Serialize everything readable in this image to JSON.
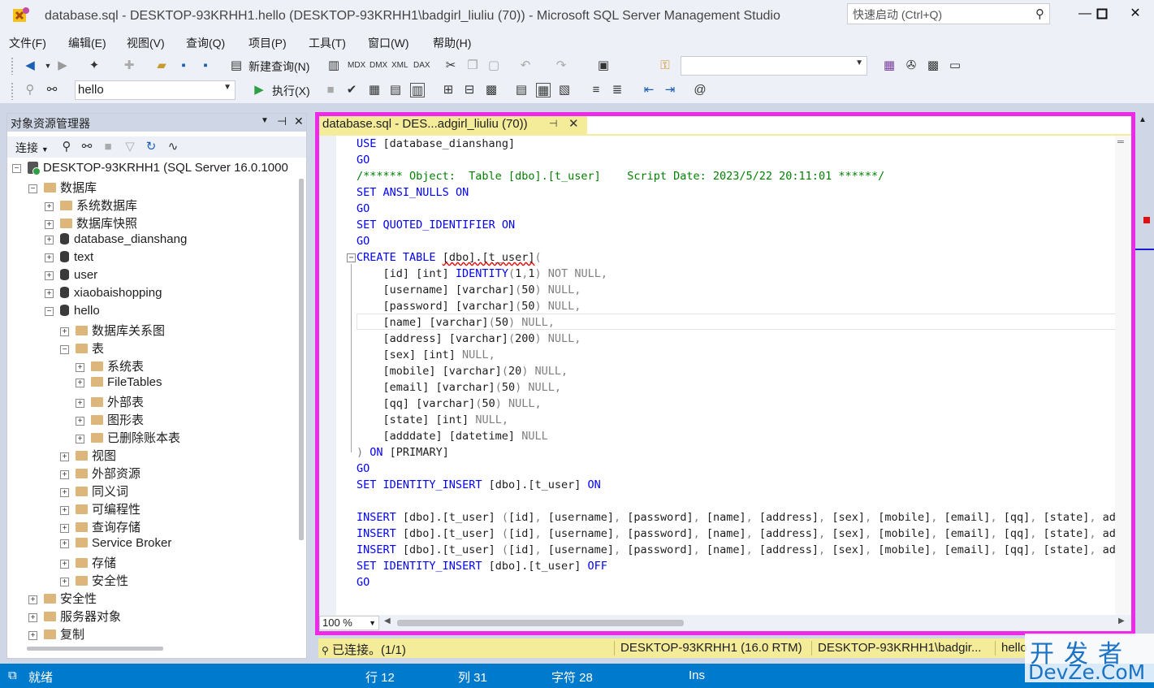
{
  "window": {
    "title": "database.sql - DESKTOP-93KRHH1.hello (DESKTOP-93KRHH1\\badgirl_liuliu (70)) - Microsoft SQL Server Management Studio",
    "quick_launch_placeholder": "快速启动 (Ctrl+Q)",
    "minimize": "—",
    "maximize": "☐",
    "close": "✕"
  },
  "menu": [
    "文件(F)",
    "编辑(E)",
    "视图(V)",
    "查询(Q)",
    "项目(P)",
    "工具(T)",
    "窗口(W)",
    "帮助(H)"
  ],
  "toolbar": {
    "new_query": "新建查询(N)",
    "icons_row1": [
      "mdx-icon",
      "dmx-icon",
      "xmla-icon",
      "dax-icon"
    ],
    "database_select": "hello",
    "execute": "执行(X)"
  },
  "object_explorer": {
    "title": "对象资源管理器",
    "connect": "连接",
    "tree": [
      {
        "label": "DESKTOP-93KRHH1 (SQL Server 16.0.1000",
        "level": 0,
        "expander": "−",
        "icon": "server"
      },
      {
        "label": "数据库",
        "level": 1,
        "expander": "−",
        "icon": "folder"
      },
      {
        "label": "系统数据库",
        "level": 2,
        "expander": "+",
        "icon": "folder"
      },
      {
        "label": "数据库快照",
        "level": 2,
        "expander": "+",
        "icon": "folder"
      },
      {
        "label": "database_dianshang",
        "level": 2,
        "expander": "+",
        "icon": "db"
      },
      {
        "label": "text",
        "level": 2,
        "expander": "+",
        "icon": "db"
      },
      {
        "label": "user",
        "level": 2,
        "expander": "+",
        "icon": "db"
      },
      {
        "label": "xiaobaishopping",
        "level": 2,
        "expander": "+",
        "icon": "db"
      },
      {
        "label": "hello",
        "level": 2,
        "expander": "−",
        "icon": "db"
      },
      {
        "label": "数据库关系图",
        "level": 3,
        "expander": "+",
        "icon": "folder"
      },
      {
        "label": "表",
        "level": 3,
        "expander": "−",
        "icon": "folder"
      },
      {
        "label": "系统表",
        "level": 4,
        "expander": "+",
        "icon": "folder"
      },
      {
        "label": "FileTables",
        "level": 4,
        "expander": "+",
        "icon": "folder"
      },
      {
        "label": "外部表",
        "level": 4,
        "expander": "+",
        "icon": "folder"
      },
      {
        "label": "图形表",
        "level": 4,
        "expander": "+",
        "icon": "folder"
      },
      {
        "label": "已删除账本表",
        "level": 4,
        "expander": "+",
        "icon": "folder"
      },
      {
        "label": "视图",
        "level": 3,
        "expander": "+",
        "icon": "folder"
      },
      {
        "label": "外部资源",
        "level": 3,
        "expander": "+",
        "icon": "folder"
      },
      {
        "label": "同义词",
        "level": 3,
        "expander": "+",
        "icon": "folder"
      },
      {
        "label": "可编程性",
        "level": 3,
        "expander": "+",
        "icon": "folder"
      },
      {
        "label": "查询存储",
        "level": 3,
        "expander": "+",
        "icon": "folder"
      },
      {
        "label": "Service Broker",
        "level": 3,
        "expander": "+",
        "icon": "folder"
      },
      {
        "label": "存储",
        "level": 3,
        "expander": "+",
        "icon": "folder"
      },
      {
        "label": "安全性",
        "level": 3,
        "expander": "+",
        "icon": "folder"
      },
      {
        "label": "安全性",
        "level": 1,
        "expander": "+",
        "icon": "folder"
      },
      {
        "label": "服务器对象",
        "level": 1,
        "expander": "+",
        "icon": "folder"
      },
      {
        "label": "复制",
        "level": 1,
        "expander": "+",
        "icon": "folder"
      }
    ]
  },
  "editor": {
    "tab_title": "database.sql - DES...adgirl_liuliu (70))",
    "tab_pin": "⊣",
    "tab_close": "✕",
    "zoom": "100 %",
    "lines": [
      "USE [database_dianshang]",
      "GO",
      "/****** Object:  Table [dbo].[t_user]    Script Date: 2023/5/22 20:11:01 ******/",
      "SET ANSI_NULLS ON",
      "GO",
      "SET QUOTED_IDENTIFIER ON",
      "GO",
      "CREATE TABLE [dbo].[t_user](",
      "    [id] [int] IDENTITY(1,1) NOT NULL,",
      "    [username] [varchar](50) NULL,",
      "    [password] [varchar](50) NULL,",
      "    [name] [varchar](50) NULL,",
      "    [address] [varchar](200) NULL,",
      "    [sex] [int] NULL,",
      "    [mobile] [varchar](20) NULL,",
      "    [email] [varchar](50) NULL,",
      "    [qq] [varchar](50) NULL,",
      "    [state] [int] NULL,",
      "    [adddate] [datetime] NULL",
      ") ON [PRIMARY]",
      "GO",
      "SET IDENTITY_INSERT [dbo].[t_user] ON",
      "",
      "INSERT [dbo].[t_user] ([id], [username], [password], [name], [address], [sex], [mobile], [email], [qq], [state], [addda",
      "INSERT [dbo].[t_user] ([id], [username], [password], [name], [address], [sex], [mobile], [email], [qq], [state], [addda",
      "INSERT [dbo].[t_user] ([id], [username], [password], [name], [address], [sex], [mobile], [email], [qq], [state], [addda",
      "SET IDENTITY_INSERT [dbo].[t_user] OFF",
      "GO"
    ]
  },
  "query_status": {
    "connected": "已连接。(1/1)",
    "server": "DESKTOP-93KRHH1 (16.0 RTM)",
    "user": "DESKTOP-93KRHH1\\badgir...",
    "db": "hello"
  },
  "statusbar": {
    "ready": "就绪",
    "line": "行 12",
    "col": "列 31",
    "ch": "字符 28",
    "mode": "Ins"
  },
  "watermark": {
    "line1": "开发者",
    "line2": "DevZe.CoM"
  },
  "colors": {
    "highlight_frame": "#ec2ae8",
    "statusbar": "#007acc",
    "tab_yellow": "#f5ec9a"
  }
}
